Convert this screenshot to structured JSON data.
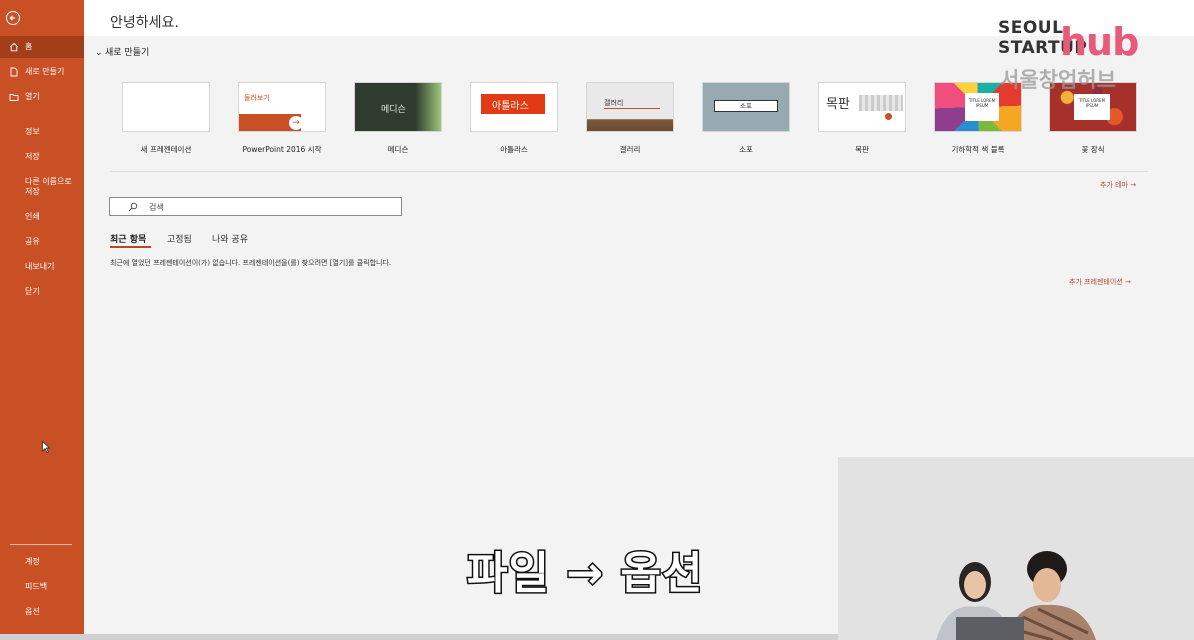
{
  "sidebar": {
    "items": [
      {
        "label": "홈",
        "icon": "home-icon"
      },
      {
        "label": "새로 만들기",
        "icon": "new-file-icon"
      },
      {
        "label": "열기",
        "icon": "folder-icon"
      },
      {
        "label": "정보"
      },
      {
        "label": "저장"
      },
      {
        "label": "다른 이름으로\n저장"
      },
      {
        "label": "인쇄"
      },
      {
        "label": "공유"
      },
      {
        "label": "내보내기"
      },
      {
        "label": "닫기"
      }
    ],
    "bottom_items": [
      {
        "label": "계정"
      },
      {
        "label": "피드백"
      },
      {
        "label": "옵션"
      }
    ],
    "accent": "#c94f25"
  },
  "greeting": "안녕하세요.",
  "new_section": {
    "title": "새로 만들기",
    "templates": [
      {
        "name": "새 프레젠테이션",
        "thumb_text": ""
      },
      {
        "name": "PowerPoint 2016 시작",
        "thumb_text": "둘러보기"
      },
      {
        "name": "메디슨",
        "thumb_text": "메디슨"
      },
      {
        "name": "아틀라스",
        "thumb_text": "아틀라스"
      },
      {
        "name": "갤러리",
        "thumb_text": "갤러리"
      },
      {
        "name": "소포",
        "thumb_text": "소포"
      },
      {
        "name": "목판",
        "thumb_text": "목판"
      },
      {
        "name": "기하학적 색 블록",
        "thumb_text": "TITLE LOREM IPSUM"
      },
      {
        "name": "꽃 장식",
        "thumb_text": "TITLE LOREM IPSUM"
      }
    ],
    "more_themes": "추가 테마 →"
  },
  "search": {
    "placeholder": "검색"
  },
  "tabs": [
    {
      "label": "최근 항목",
      "active": true
    },
    {
      "label": "고정됨",
      "active": false
    },
    {
      "label": "나와 공유",
      "active": false
    }
  ],
  "empty_message": "최근에 열었던 프레젠테이션이(가) 없습니다. 프레젠테이션을(를) 찾으려면 [열기]를 클릭합니다.",
  "more_presentations": "추가 프레젠테이션 →",
  "overlay": {
    "caption": "파일 → 옵션",
    "logo": {
      "line1": "SEOUL",
      "line2": "STARTUP",
      "hub": "hub",
      "korean": "서울창업허브"
    }
  }
}
